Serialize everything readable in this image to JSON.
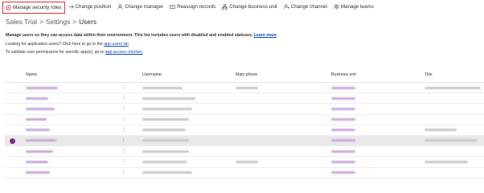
{
  "toolbar": {
    "items": [
      {
        "label": "Manage security roles",
        "icon": "shield-icon"
      },
      {
        "label": "Change position",
        "icon": "arrows-icon"
      },
      {
        "label": "Change manager",
        "icon": "person-icon"
      },
      {
        "label": "Reassign records",
        "icon": "reassign-icon"
      },
      {
        "label": "Change business unit",
        "icon": "org-icon"
      },
      {
        "label": "Change channel",
        "icon": "person-swap-icon"
      },
      {
        "label": "Manage teams",
        "icon": "team-icon"
      }
    ]
  },
  "breadcrumb": {
    "items": [
      "Sales Trial",
      ">",
      "Settings",
      ">",
      "Users"
    ]
  },
  "info": {
    "line1_text": "Manage users so they can access data within their environment. This list includes users with disabled and enabled statuses.",
    "line1_link": "Learn more",
    "line2_text": "Looking for application users? Click here to go to the",
    "line2_link": "app users list",
    "line3_text": "To validate user permissions for specific app(s), go to",
    "line3_link": "app access checker."
  },
  "grid": {
    "columns": [
      "Name",
      "Username",
      "Main phone",
      "Business unit",
      "Title"
    ]
  },
  "colors": {
    "highlight_border": "#d13438",
    "link": "#0f4bb4",
    "blurred_link": "#cda7dd"
  }
}
